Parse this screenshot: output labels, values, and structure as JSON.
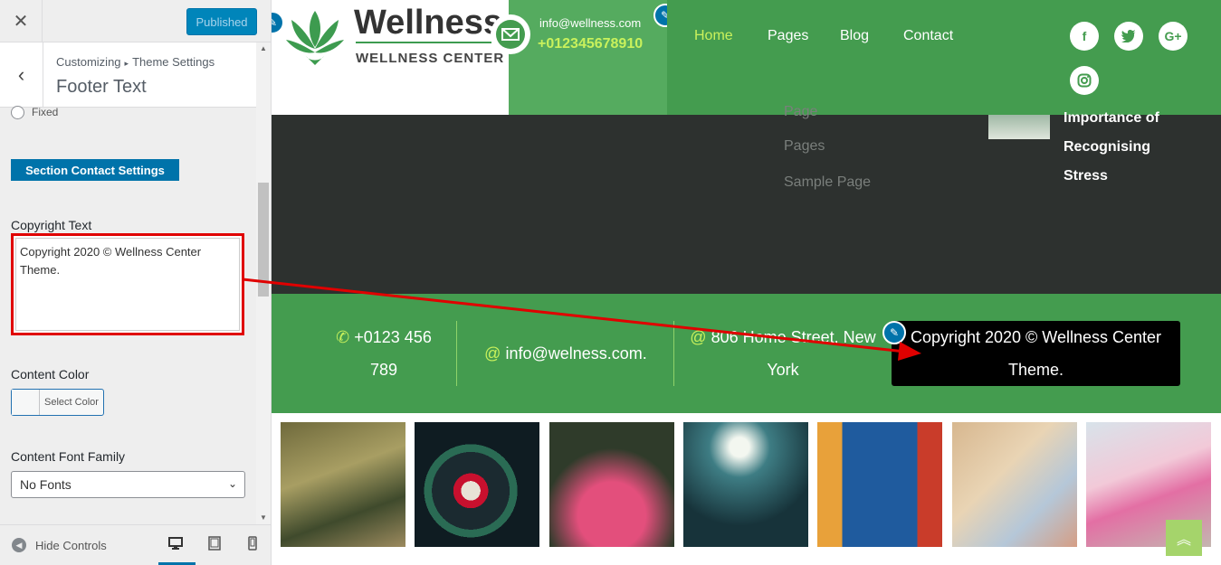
{
  "customizer": {
    "close_icon": "close-icon",
    "publish_label": "Published",
    "breadcrumb_root": "Customizing",
    "breadcrumb_sep": "▸",
    "breadcrumb_parent": "Theme Settings",
    "section_title": "Footer Text",
    "fixed_label": "Fixed",
    "section_contact_label": "Section Contact Settings",
    "copyright_label": "Copyright Text",
    "copyright_value": "Copyright 2020 © Wellness Center Theme.",
    "content_color_label": "Content Color",
    "select_color_label": "Select Color",
    "font_family_label": "Content Font Family",
    "font_family_value": "No Fonts",
    "hide_controls_label": "Hide Controls",
    "accent_color": "#0073aa"
  },
  "site": {
    "logo_name": "Wellness",
    "logo_tagline": "WELLNESS CENTER",
    "email": "info@wellness.com",
    "phone": "+012345678910",
    "nav": [
      "Home",
      "Pages",
      "Blog",
      "Contact"
    ],
    "social": [
      "facebook-icon",
      "twitter-icon",
      "google-plus-icon",
      "instagram-icon"
    ],
    "footer_links": [
      "Page",
      "Pages",
      "Sample Page"
    ],
    "blog_title_lines": [
      "Importance of",
      "Recognising",
      "Stress"
    ],
    "contact_phone_lines": [
      "+0123 456",
      "789"
    ],
    "contact_email": "info@welness.com.",
    "contact_address_lines": [
      "806 Home Street, New",
      "York"
    ],
    "copyright_lines": [
      "Copyright 2020 © Wellness Center",
      "Theme."
    ],
    "primary_green": "#449c4f",
    "highlight_green": "#c9f15c"
  }
}
